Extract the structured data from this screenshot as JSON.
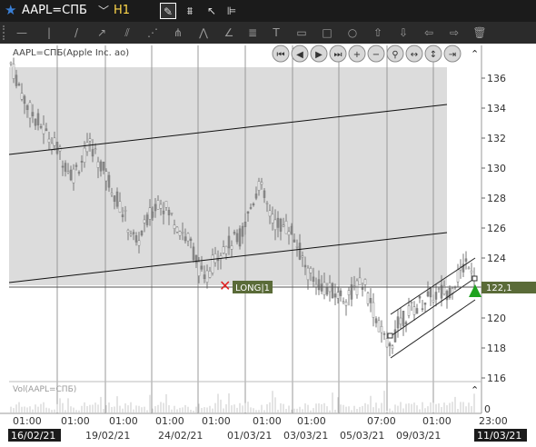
{
  "header": {
    "symbol": "AAPL=СПБ",
    "timeframe": "H1"
  },
  "chart": {
    "title": "AAPL=СПБ(Apple Inc. ao)",
    "volume_label": "Vol(AAPL=СПБ)",
    "price_ticks": [
      "136",
      "134",
      "132",
      "130",
      "128",
      "126",
      "124",
      "122",
      "120",
      "118",
      "116"
    ],
    "volume_tick": "0",
    "current_price": "122,1",
    "position_label": "LONG|1",
    "time_ticks": [
      "01:00",
      "01:00",
      "01:00",
      "01:00",
      "01:00",
      "01:00",
      "01:00",
      "07:00",
      "01:00",
      "23:00"
    ],
    "date_ticks": [
      "16/02/21",
      "19/02/21",
      "24/02/21",
      "01/03/21",
      "03/03/21",
      "05/03/21",
      "09/03/21",
      "11/03/21"
    ]
  },
  "chart_data": {
    "type": "candlestick",
    "ylim": [
      115,
      137
    ],
    "start_price": 135.8,
    "end_price": 122.1
  },
  "colors": {
    "topbar": "#1b1b1b",
    "toolbar": "#2b2b2b",
    "price_badge": "#5a6b38",
    "long_marker": "#e02020",
    "up_arrow": "#1fa31f",
    "timeframe": "#ffd84a"
  }
}
